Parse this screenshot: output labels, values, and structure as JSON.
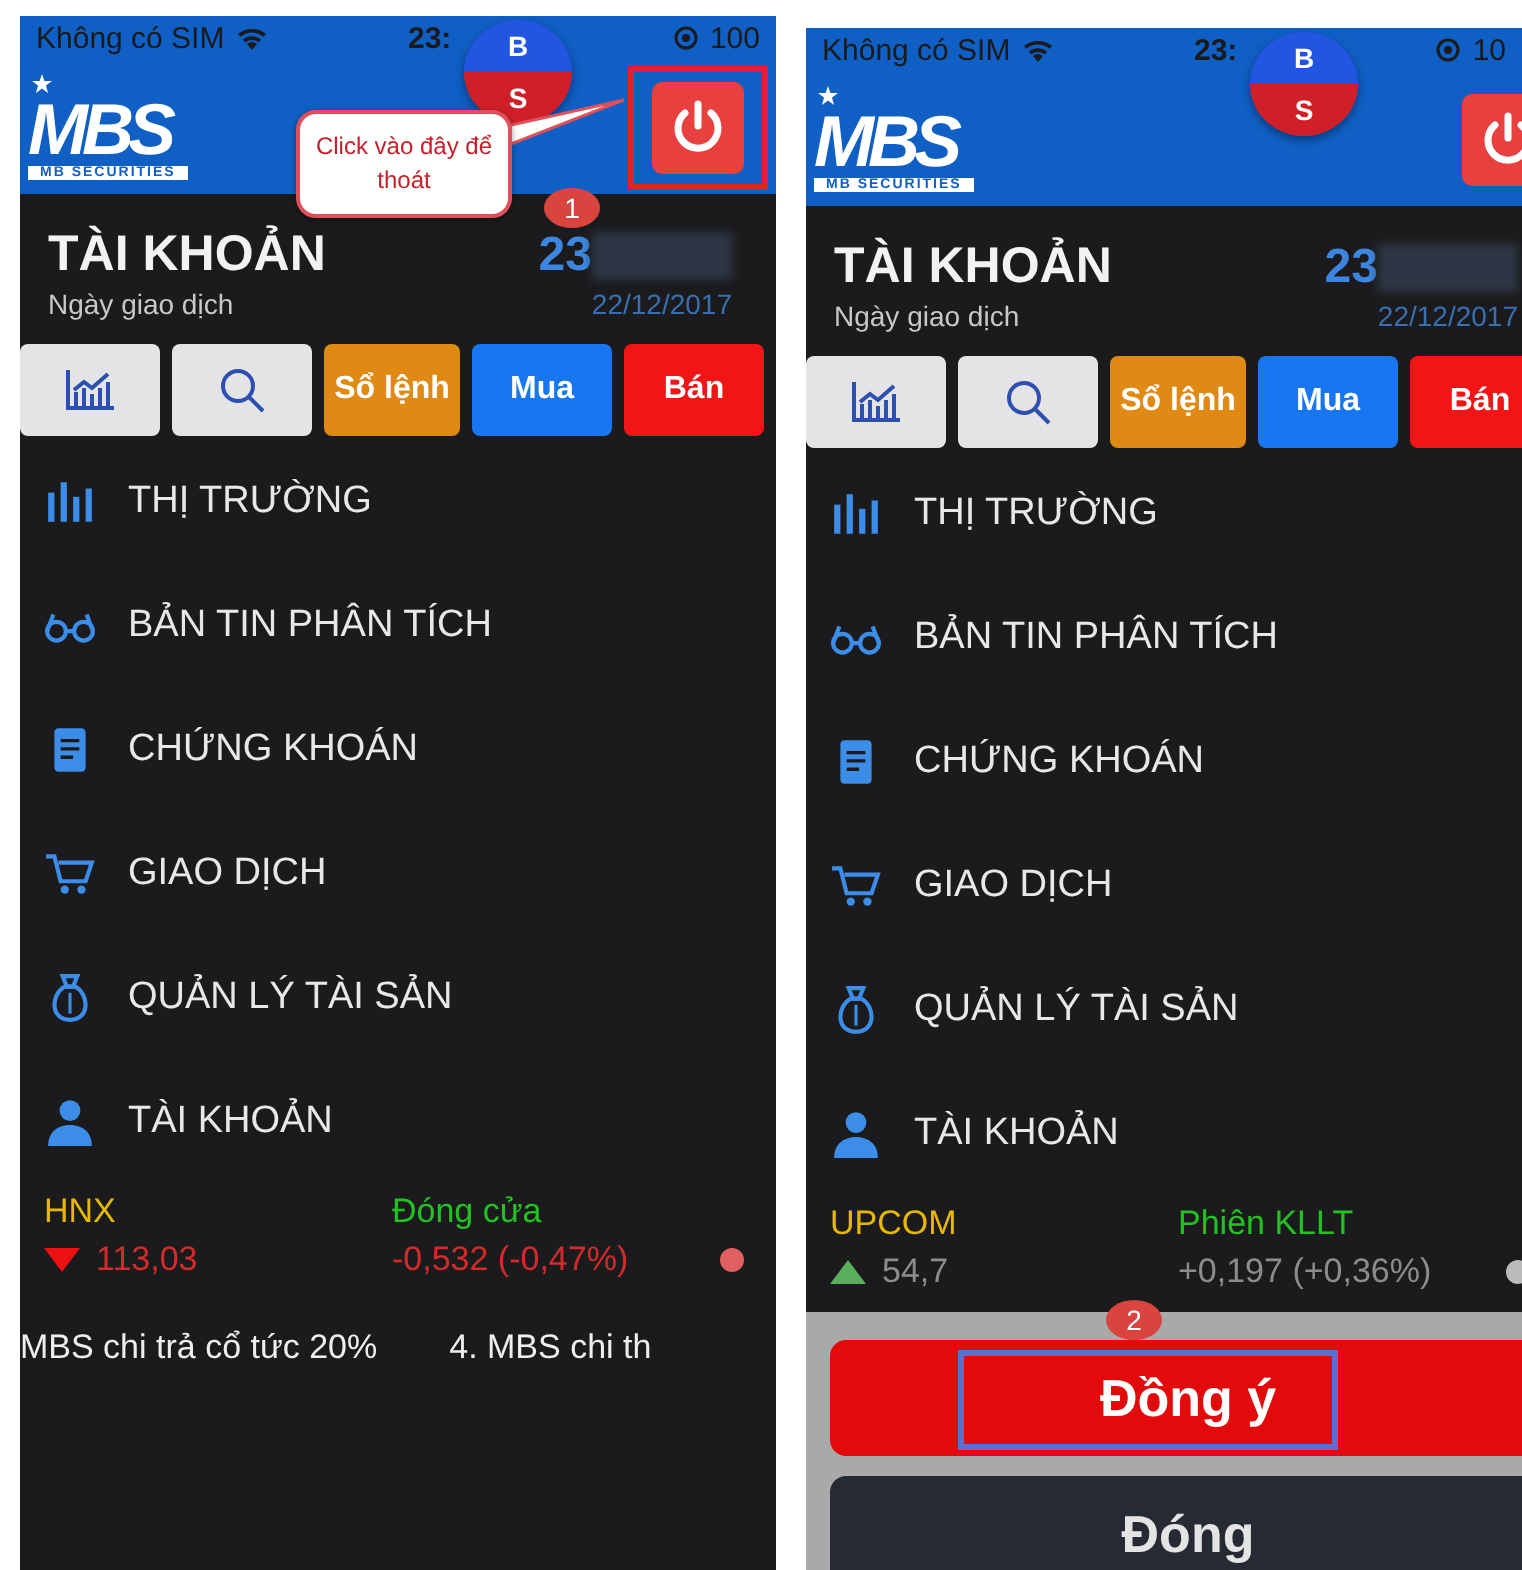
{
  "phones": [
    {
      "status": {
        "carrier": "Không có SIM",
        "time": "23:",
        "battery": "100"
      },
      "logo": {
        "brand": "MBS",
        "tagline": "MB SECURITIES"
      },
      "bubble": [
        "B",
        "S"
      ],
      "account": {
        "title": "TÀI KHOẢN",
        "number": "23",
        "date_label": "Ngày giao dịch",
        "date": "22/12/2017"
      },
      "actions": [
        {
          "kind": "chart"
        },
        {
          "kind": "search"
        },
        {
          "kind": "orders",
          "label": "Sổ lệnh"
        },
        {
          "kind": "buy",
          "label": "Mua"
        },
        {
          "kind": "sell",
          "label": "Bán"
        }
      ],
      "menu": [
        {
          "kind": "bars",
          "label": "THỊ TRƯỜNG"
        },
        {
          "kind": "glasses",
          "label": "BẢN TIN PHÂN TÍCH"
        },
        {
          "kind": "document",
          "label": "CHỨNG KHOÁN"
        },
        {
          "kind": "cart",
          "label": "GIAO DỊCH"
        },
        {
          "kind": "moneybag",
          "label": "QUẢN LÝ TÀI SẢN"
        },
        {
          "kind": "person",
          "label": "TÀI KHOẢN"
        }
      ],
      "ticker": {
        "index": "HNX",
        "session": "Đóng cửa",
        "rising": false,
        "value": "113,03",
        "change": "-0,532 (-0,47%)"
      },
      "news": [
        "MBS chi trả cổ tức 20%",
        "4. MBS chi th"
      ],
      "callout": "Click vào đây để thoát",
      "step": "1"
    },
    {
      "status": {
        "carrier": "Không có SIM",
        "time": "23:",
        "battery": "10"
      },
      "logo": {
        "brand": "MBS",
        "tagline": "MB SECURITIES"
      },
      "bubble": [
        "B",
        "S"
      ],
      "account": {
        "title": "TÀI KHOẢN",
        "number": "23",
        "date_label": "Ngày giao dịch",
        "date": "22/12/2017"
      },
      "actions": [
        {
          "kind": "chart"
        },
        {
          "kind": "search"
        },
        {
          "kind": "orders",
          "label": "Sổ lệnh"
        },
        {
          "kind": "buy",
          "label": "Mua"
        },
        {
          "kind": "sell",
          "label": "Bán"
        }
      ],
      "menu": [
        {
          "kind": "bars",
          "label": "THỊ TRƯỜNG"
        },
        {
          "kind": "glasses",
          "label": "BẢN TIN PHÂN TÍCH"
        },
        {
          "kind": "document",
          "label": "CHỨNG KHOÁN"
        },
        {
          "kind": "cart",
          "label": "GIAO DỊCH"
        },
        {
          "kind": "moneybag",
          "label": "QUẢN LÝ TÀI SẢN"
        },
        {
          "kind": "person",
          "label": "TÀI KHOẢN"
        }
      ],
      "ticker": {
        "index": "UPCOM",
        "session": "Phiên KLLT",
        "rising": true,
        "value": "54,7",
        "change": "+0,197 (+0,36%)"
      },
      "dialog": {
        "step": "2",
        "buttons": [
          {
            "kind": "confirm",
            "label": "Đồng ý"
          },
          {
            "kind": "close",
            "label": "Đóng"
          }
        ]
      }
    }
  ]
}
